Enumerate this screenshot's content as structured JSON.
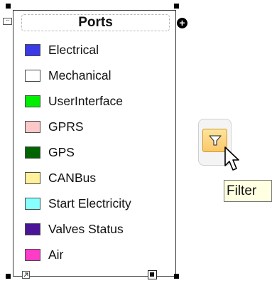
{
  "legend": {
    "title": "Ports",
    "items": [
      {
        "label": "Electrical",
        "color": "#3a3ae6"
      },
      {
        "label": "Mechanical",
        "color": "#ffffff"
      },
      {
        "label": "UserInterface",
        "color": "#00ee00"
      },
      {
        "label": "GPRS",
        "color": "#ffc8c8"
      },
      {
        "label": "GPS",
        "color": "#006400"
      },
      {
        "label": "CANBus",
        "color": "#fff09a"
      },
      {
        "label": "Start Electricity",
        "color": "#88ffff"
      },
      {
        "label": "Valves Status",
        "color": "#4a1596"
      },
      {
        "label": "Air",
        "color": "#ff3cc8"
      }
    ]
  },
  "icons": {
    "collapse": "collapse-icon",
    "add": "add-circle-icon",
    "filter": "filter-funnel-icon",
    "cursor": "mouse-pointer-icon"
  },
  "filter": {
    "tooltip": "Filter",
    "button_color": "#fbd27a"
  },
  "colors": {
    "border": "#3a3a3a",
    "tooltip_bg": "#ffffe1"
  }
}
